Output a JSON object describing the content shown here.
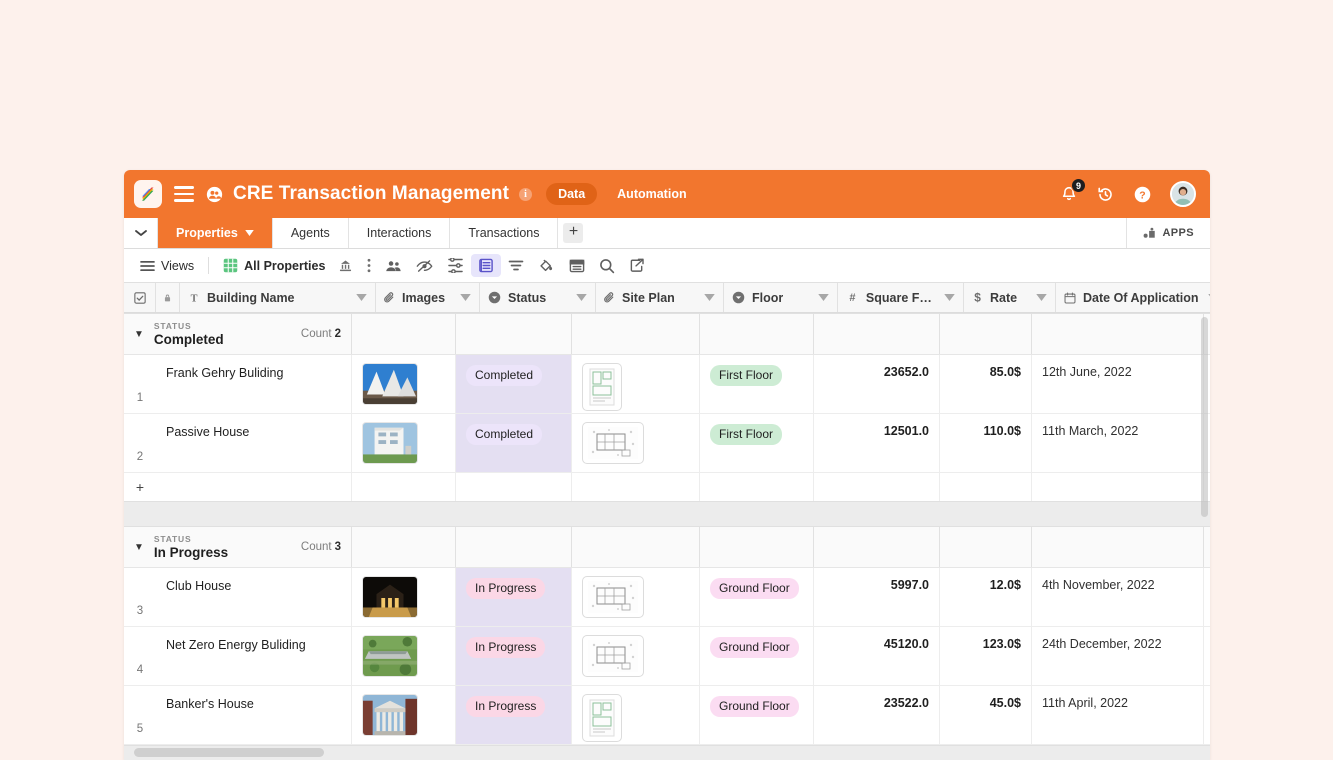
{
  "colors": {
    "brand_orange": "#f2762e",
    "page_background": "#fdf1ec",
    "status_column_tint": "#e4dff2",
    "badge_completed": "#ece4fa",
    "badge_in_progress": "#fbd7e6",
    "badge_first_floor": "#cdecd4",
    "badge_ground_floor": "#fbdcf2"
  },
  "topbar": {
    "logo_name": "app-logo",
    "menu_icon": "hamburger-icon",
    "workspace_icon": "team-members-icon",
    "title": "CRE Transaction Management",
    "info_icon": "info-icon",
    "info_glyph": "i",
    "data_pill": "Data",
    "automation_link": "Automation",
    "notifications": {
      "icon": "bell-icon",
      "count": "9"
    },
    "history_icon": "history-undo-icon",
    "help_icon": "help-question-icon",
    "avatar": "user-avatar"
  },
  "tabbar": {
    "caret_icon": "chevron-down-icon",
    "tabs": [
      {
        "label": "Properties",
        "active": true,
        "caret": "chevron-down-icon"
      },
      {
        "label": "Agents",
        "active": false
      },
      {
        "label": "Interactions",
        "active": false
      },
      {
        "label": "Transactions",
        "active": false
      }
    ],
    "add_tab": "+",
    "apps_label": "APPS",
    "apps_icon": "apps-icon"
  },
  "toolbar": {
    "views_icon": "list-lines-icon",
    "views_label": "Views",
    "grid_icon": "grid-view-icon",
    "view_name": "All Properties",
    "view_lock_icon": "view-lock-icon",
    "more_icon": "kebab-menu-icon",
    "icons": [
      {
        "name": "share-collaborators-icon",
        "selected": false
      },
      {
        "name": "hide-fields-eye-slash-icon",
        "selected": false
      },
      {
        "name": "field-settings-sliders-icon",
        "selected": false
      },
      {
        "name": "row-height-icon",
        "selected": true
      },
      {
        "name": "filter-icon",
        "selected": false
      },
      {
        "name": "color-fill-icon",
        "selected": false
      },
      {
        "name": "group-summary-icon",
        "selected": false
      },
      {
        "name": "search-icon",
        "selected": false
      },
      {
        "name": "share-export-icon",
        "selected": false
      }
    ]
  },
  "grid": {
    "select_all_icon": "checkbox-icon",
    "lock_icon": "lock-icon",
    "columns": [
      {
        "label": "Building Name",
        "type_icon": "text-type-icon"
      },
      {
        "label": "Images",
        "type_icon": "attachment-paperclip-icon"
      },
      {
        "label": "Status",
        "type_icon": "single-select-icon"
      },
      {
        "label": "Site Plan",
        "type_icon": "attachment-paperclip-icon"
      },
      {
        "label": "Floor",
        "type_icon": "single-select-icon"
      },
      {
        "label": "Square Feet",
        "type_icon": "number-hash-icon"
      },
      {
        "label": "Rate",
        "type_icon": "currency-dollar-icon"
      },
      {
        "label": "Date Of Application",
        "type_icon": "calendar-date-icon"
      }
    ],
    "caret_icon": "chevron-down-icon",
    "add_record_label": "+",
    "groups": [
      {
        "kind_label": "STATUS",
        "value": "Completed",
        "count_label": "Count",
        "count": "2",
        "rows": [
          {
            "index": "1",
            "building_name": "Frank Gehry Buliding",
            "image": "frank-gehry-building-photo",
            "status": "Completed",
            "status_style": "purple",
            "site_plan": "site-plan-thumbnail-tall",
            "floor": "First Floor",
            "floor_style": "green",
            "square_feet": "23652.0",
            "rate": "85.0$",
            "date": "12th June, 2022"
          },
          {
            "index": "2",
            "building_name": "Passive House",
            "image": "passive-house-photo",
            "status": "Completed",
            "status_style": "purple",
            "site_plan": "site-plan-thumbnail-wide",
            "floor": "First Floor",
            "floor_style": "green",
            "square_feet": "12501.0",
            "rate": "110.0$",
            "date": "11th March, 2022"
          }
        ]
      },
      {
        "kind_label": "STATUS",
        "value": "In Progress",
        "count_label": "Count",
        "count": "3",
        "rows": [
          {
            "index": "3",
            "building_name": "Club House",
            "image": "club-house-night-photo",
            "status": "In Progress",
            "status_style": "pink",
            "site_plan": "site-plan-thumbnail-wide",
            "floor": "Ground Floor",
            "floor_style": "pink",
            "square_feet": "5997.0",
            "rate": "12.0$",
            "date": "4th November, 2022"
          },
          {
            "index": "4",
            "building_name": "Net Zero Energy Buliding",
            "image": "net-zero-energy-building-photo",
            "status": "In Progress",
            "status_style": "pink",
            "site_plan": "site-plan-thumbnail-wide",
            "floor": "Ground Floor",
            "floor_style": "pink",
            "square_feet": "45120.0",
            "rate": "123.0$",
            "date": "24th December, 2022"
          },
          {
            "index": "5",
            "building_name": "Banker's House",
            "image": "bankers-house-photo",
            "status": "In Progress",
            "status_style": "pink",
            "site_plan": "site-plan-thumbnail-tall",
            "floor": "Ground Floor",
            "floor_style": "pink",
            "square_feet": "23522.0",
            "rate": "45.0$",
            "date": "11th April, 2022"
          }
        ]
      }
    ]
  },
  "scrollbars": {
    "vertical": "vertical-scrollbar",
    "horizontal": "horizontal-scrollbar"
  }
}
